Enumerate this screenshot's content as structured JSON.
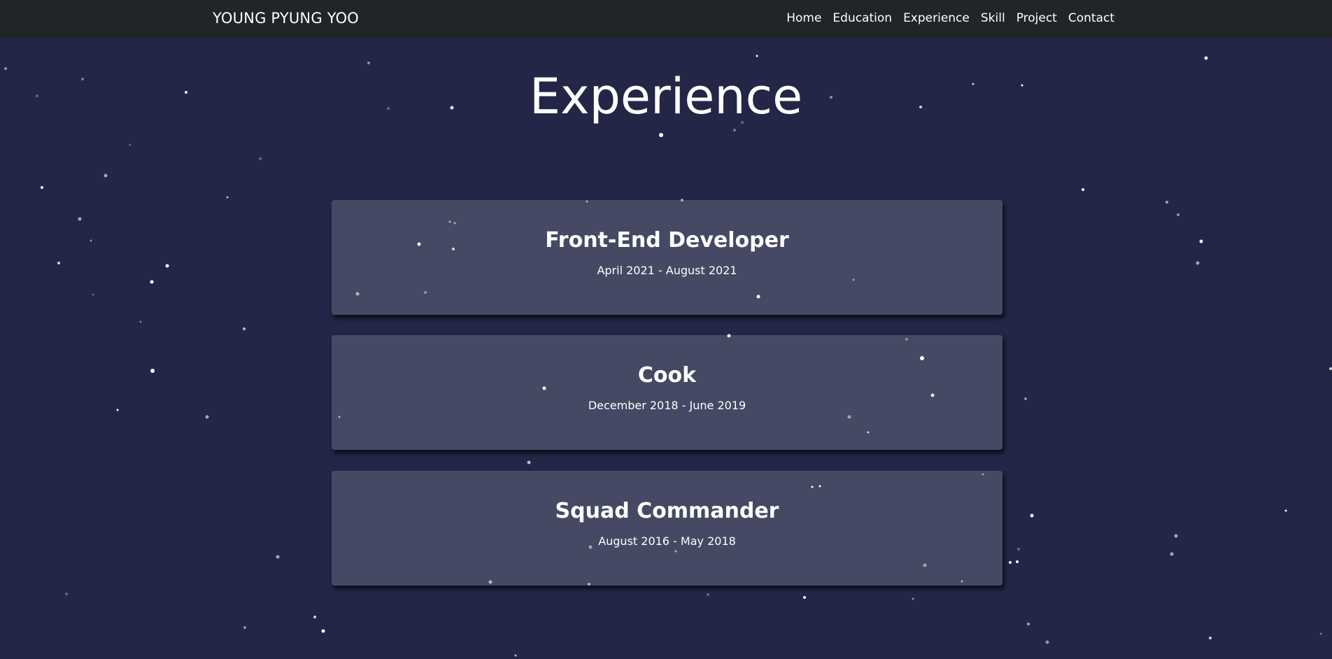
{
  "navbar": {
    "brand": "YOUNG PYUNG YOO",
    "links": [
      "Home",
      "Education",
      "Experience",
      "Skill",
      "Project",
      "Contact"
    ]
  },
  "section": {
    "title": "Experience"
  },
  "experiences": [
    {
      "title": "Front-End Developer",
      "date": "April 2021 - August 2021"
    },
    {
      "title": "Cook",
      "date": "December 2018 - June 2019"
    },
    {
      "title": "Squad Commander",
      "date": "August 2016 - May 2018"
    }
  ],
  "colors": {
    "background": "#232646",
    "navbar": "#212529",
    "card": "#464963",
    "text": "#ffffff"
  }
}
